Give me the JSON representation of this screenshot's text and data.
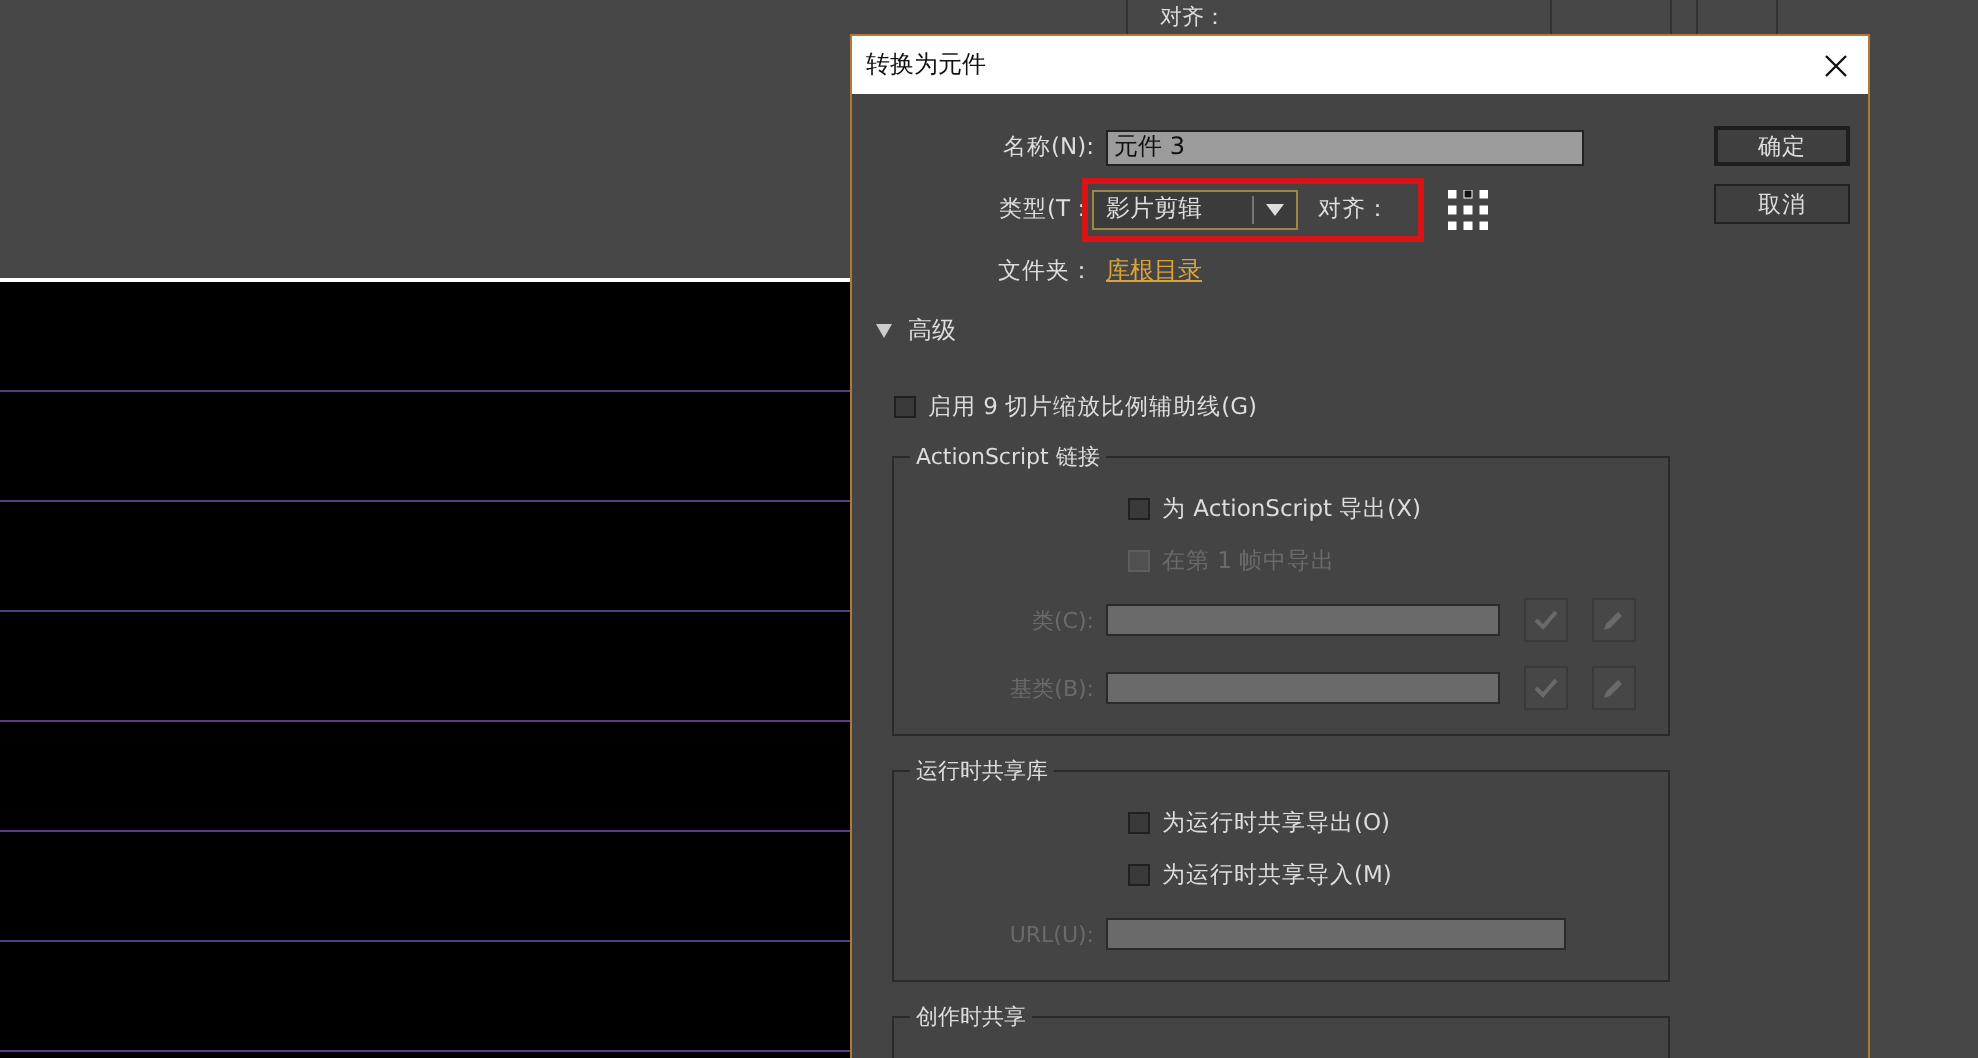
{
  "background_panel": {
    "label": "对齐："
  },
  "dialog": {
    "title": "转换为元件",
    "name": {
      "label": "名称(N):",
      "value": "元件 3"
    },
    "type": {
      "label": "类型(T：",
      "value": "影片剪辑",
      "highlighted": true
    },
    "align": {
      "label": "对齐："
    },
    "folder": {
      "label": "文件夹：",
      "value": "库根目录"
    },
    "buttons": [
      {
        "label": "确定",
        "default": true
      },
      {
        "label": "取消",
        "default": false
      }
    ],
    "advanced": {
      "label": "高级",
      "expanded": true
    },
    "nine_slice": {
      "label": "启用 9 切片缩放比例辅助线(G)",
      "checked": false
    },
    "groups": [
      {
        "title": "ActionScript 链接",
        "rows": [
          {
            "kind": "checkbox",
            "label": "为 ActionScript 导出(X)",
            "checked": false,
            "disabled": false
          },
          {
            "kind": "checkbox",
            "label": "在第 1 帧中导出",
            "checked": false,
            "disabled": true
          },
          {
            "kind": "field",
            "label": "类(C):",
            "disabled": true,
            "tools": true
          },
          {
            "kind": "field",
            "label": "基类(B):",
            "disabled": true,
            "tools": true
          }
        ]
      },
      {
        "title": "运行时共享库",
        "rows": [
          {
            "kind": "checkbox",
            "label": "为运行时共享导出(O)",
            "checked": false,
            "disabled": false
          },
          {
            "kind": "checkbox",
            "label": "为运行时共享导入(M)",
            "checked": false,
            "disabled": false
          },
          {
            "kind": "field",
            "label": "URL(U):",
            "disabled": true,
            "tools": false
          }
        ]
      },
      {
        "title": "创作时共享"
      }
    ]
  }
}
